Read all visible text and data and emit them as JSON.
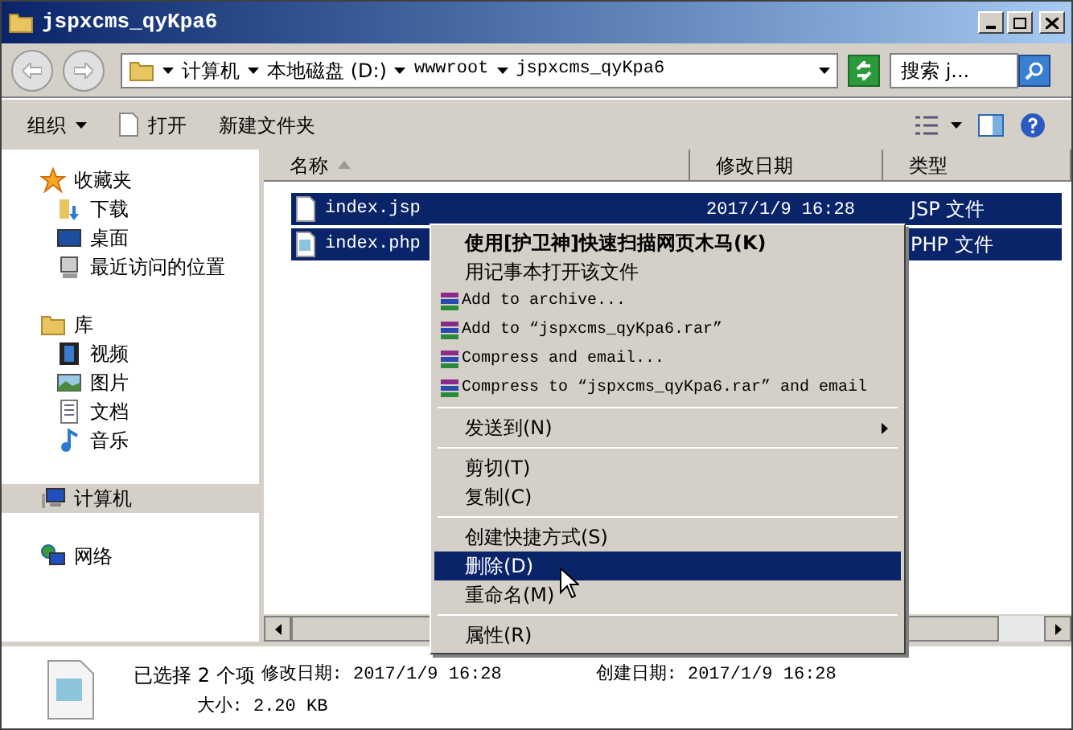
{
  "window": {
    "title": "jspxcms_qyKpa6"
  },
  "address_bar": {
    "segments": [
      "计算机",
      "本地磁盘 (D:)",
      "wwwroot",
      "jspxcms_qyKpa6"
    ]
  },
  "search": {
    "placeholder": "搜索 j..."
  },
  "toolbar": {
    "items": [
      {
        "label": "组织",
        "kind": "menu"
      },
      {
        "label": "打开",
        "kind": "file"
      },
      {
        "label": "新建文件夹",
        "kind": "plain"
      }
    ]
  },
  "sidebar": {
    "groups": [
      {
        "label": "收藏夹",
        "selected": false,
        "children": [
          {
            "label": "下载",
            "selected": false
          },
          {
            "label": "桌面",
            "selected": false
          },
          {
            "label": "最近访问的位置",
            "selected": false
          }
        ]
      },
      {
        "label": "库",
        "selected": false,
        "children": [
          {
            "label": "视频",
            "selected": false
          },
          {
            "label": "图片",
            "selected": false
          },
          {
            "label": "文档",
            "selected": false
          },
          {
            "label": "音乐",
            "selected": false
          }
        ]
      },
      {
        "label": "计算机",
        "selected": true
      },
      {
        "label": "网络",
        "selected": false
      }
    ]
  },
  "table": {
    "columns": [
      {
        "label": "名称",
        "sorted": true
      },
      {
        "label": "修改日期",
        "sorted": false
      },
      {
        "label": "类型",
        "sorted": false
      }
    ],
    "rows": [
      {
        "name": "index.jsp",
        "modified": "2017/1/9 16:28",
        "type": "JSP 文件",
        "selected": true
      },
      {
        "name": "index.php",
        "type": "PHP 文件",
        "selected": true
      }
    ]
  },
  "context_menu": {
    "items": [
      {
        "kind": "item",
        "label": "使用[护卫神]快速扫描网页木马(K)",
        "default": true,
        "selected": false
      },
      {
        "kind": "item",
        "label": "用记事本打开该文件",
        "default": false,
        "selected": false
      },
      {
        "kind": "archive",
        "label": "Add to archive...",
        "default": false,
        "selected": false
      },
      {
        "kind": "archive",
        "label": "Add to “jspxcms_qyKpa6.rar”",
        "default": false,
        "selected": false
      },
      {
        "kind": "archive",
        "label": "Compress and email...",
        "default": false,
        "selected": false
      },
      {
        "kind": "archive",
        "label": "Compress to “jspxcms_qyKpa6.rar” and email",
        "default": false,
        "selected": false
      },
      {
        "kind": "separator"
      },
      {
        "kind": "submenu",
        "label": "发送到(N)",
        "default": false,
        "selected": false
      },
      {
        "kind": "separator"
      },
      {
        "kind": "item",
        "label": "剪切(T)",
        "default": false,
        "selected": false
      },
      {
        "kind": "item",
        "label": "复制(C)",
        "default": false,
        "selected": false
      },
      {
        "kind": "separator"
      },
      {
        "kind": "item",
        "label": "创建快捷方式(S)",
        "default": false,
        "selected": false
      },
      {
        "kind": "item",
        "label": "删除(D)",
        "default": false,
        "selected": true
      },
      {
        "kind": "item",
        "label": "重命名(M)",
        "default": false,
        "selected": false
      },
      {
        "kind": "separator"
      },
      {
        "kind": "item",
        "label": "属性(R)",
        "default": false,
        "selected": false
      }
    ]
  },
  "status_bar": {
    "selection": "已选择 2 个项",
    "modified": "修改日期: 2017/1/9 16:28",
    "created": "创建日期: 2017/1/9 16:28",
    "size": "大小: 2.20 KB"
  }
}
